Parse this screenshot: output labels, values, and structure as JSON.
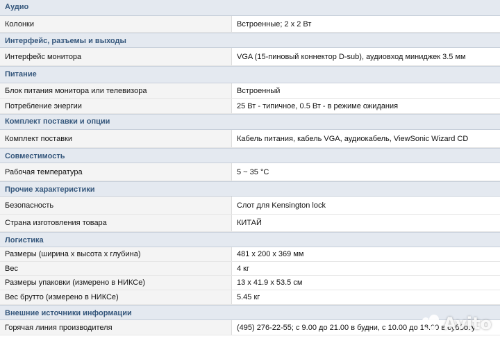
{
  "sections": [
    {
      "title": "Аудио",
      "rows": [
        {
          "key": "Колонки",
          "value": "Встроенные; 2 x 2 Вт"
        }
      ]
    },
    {
      "title": "Интерфейс, разъемы и выходы",
      "rows": [
        {
          "key": "Интерфейс монитора",
          "value": "VGA (15-пиновый коннектор D-sub), аудиовход миниджек 3.5 мм"
        }
      ]
    },
    {
      "title": "Питание",
      "rows": [
        {
          "key": "Блок питания монитора или телевизора",
          "value": "Встроенный"
        },
        {
          "key": "Потребление энергии",
          "value": "25 Вт - типичное, 0.5 Вт - в режиме ожидания"
        }
      ]
    },
    {
      "title": "Комплект поставки и опции",
      "rows": [
        {
          "key": "Комплект поставки",
          "value": "Кабель питания, кабель VGA, аудиокабель, ViewSonic Wizard CD"
        }
      ]
    },
    {
      "title": "Совместимость",
      "rows": [
        {
          "key": "Рабочая температура",
          "value": "5 ~ 35 °C"
        }
      ]
    },
    {
      "title": "Прочие характеристики",
      "rows": [
        {
          "key": "Безопасность",
          "value": "Слот для Kensington lock"
        },
        {
          "key": "Страна изготовления товара",
          "value": "КИТАЙ"
        }
      ]
    },
    {
      "title": "Логистика",
      "rows": [
        {
          "key": "Размеры (ширина x высота x глубина)",
          "value": "481 x 200 x 369 мм"
        },
        {
          "key": "Вес",
          "value": "4 кг"
        },
        {
          "key": "Размеры упаковки (измерено в НИКСе)",
          "value": "13 x 41.9 x 53.5 см"
        },
        {
          "key": "Вес брутто (измерено в НИКСе)",
          "value": "5.45 кг"
        }
      ]
    },
    {
      "title": "Внешние источники информации",
      "rows": [
        {
          "key": "Горячая линия производителя",
          "value": "(495) 276-22-55; с 9.00 до 21.00 в будни, с 10.00 до 18.00 в субботу"
        }
      ]
    }
  ],
  "watermark": {
    "text": "Avito",
    "icon": "avito-logo-icon"
  }
}
